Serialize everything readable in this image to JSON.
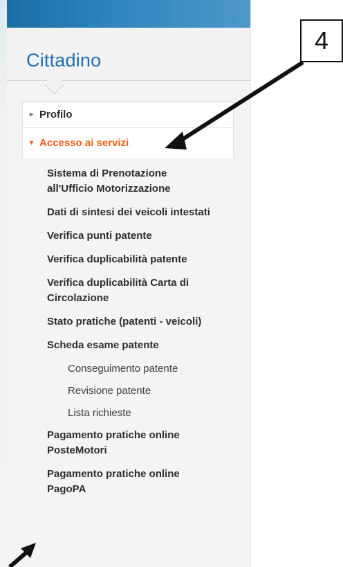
{
  "panel": {
    "title": "Cittadino"
  },
  "nav": {
    "profilo": {
      "label": "Profilo",
      "icon": "caret-right-icon"
    },
    "accesso": {
      "label": "Accesso ai servizi",
      "icon": "caret-down-icon",
      "active": true
    }
  },
  "services": {
    "items": [
      {
        "label": "Sistema di Prenotazione all'Ufficio Motorizzazione"
      },
      {
        "label": "Dati di sintesi dei veicoli intestati"
      },
      {
        "label": "Verifica punti patente"
      },
      {
        "label": "Verifica duplicabilità patente"
      },
      {
        "label": "Verifica duplicabilità Carta di Circolazione"
      },
      {
        "label": "Stato pratiche (patenti - veicoli)"
      },
      {
        "label": "Scheda esame patente"
      }
    ],
    "scheda_sub": [
      {
        "label": "Conseguimento patente"
      },
      {
        "label": "Revisione patente"
      },
      {
        "label": "Lista richieste"
      }
    ],
    "payments": [
      {
        "label": "Pagamento pratiche online PosteMotori"
      },
      {
        "label": "Pagamento pratiche online PagoPA"
      }
    ]
  },
  "annotation": {
    "callout_number": "4"
  },
  "colors": {
    "title": "#1f6fae",
    "active": "#f25b14",
    "text": "#2d2d2d",
    "panel_bg": "#f4f4f4"
  }
}
